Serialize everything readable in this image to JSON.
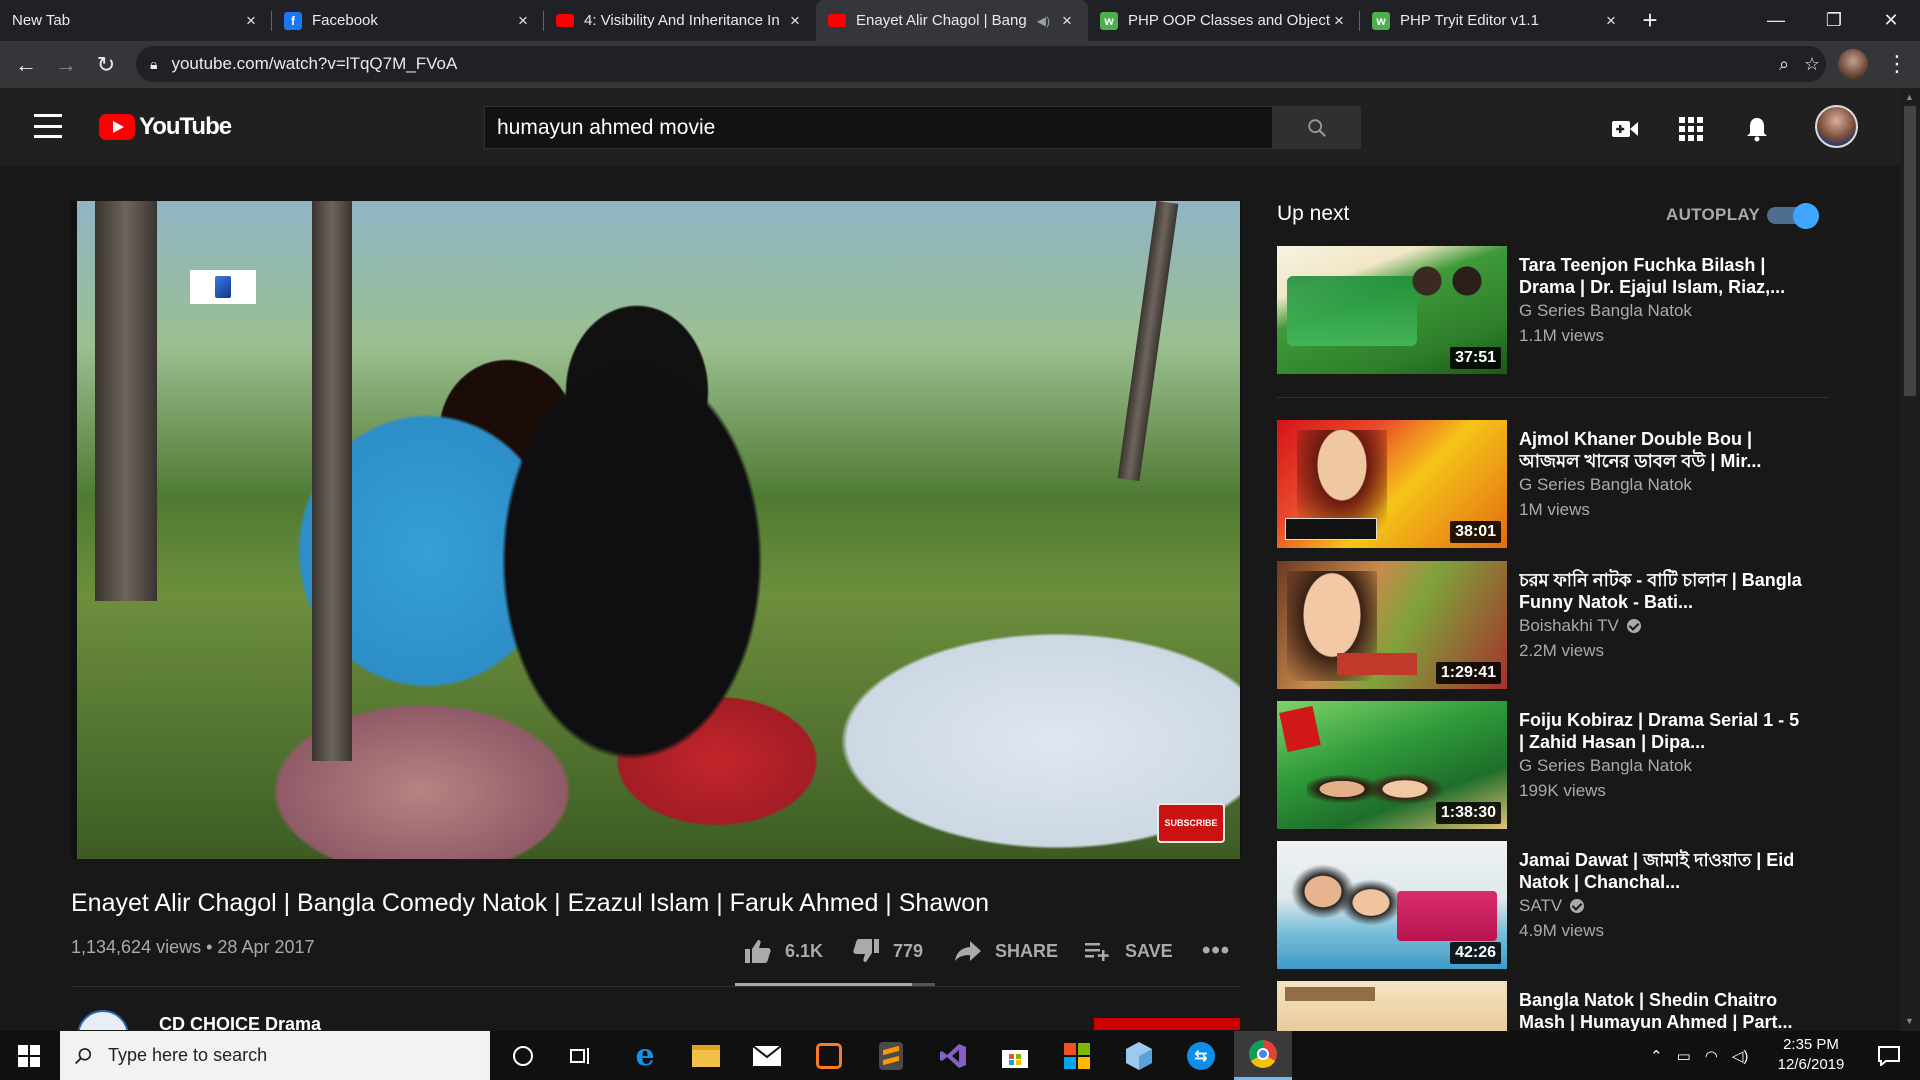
{
  "browser": {
    "tabs": [
      {
        "title": "New Tab",
        "favicon": "chrome-newtab",
        "active": false
      },
      {
        "title": "Facebook",
        "favicon": "facebook-icon",
        "active": false
      },
      {
        "title": "4: Visibility And Inheritance In",
        "favicon": "youtube-icon",
        "active": false
      },
      {
        "title": "Enayet Alir Chagol | Bang",
        "favicon": "youtube-icon",
        "active": true,
        "audio": true
      },
      {
        "title": "PHP OOP Classes and Objects",
        "favicon": "tryit-icon",
        "active": false
      },
      {
        "title": "PHP Tryit Editor v1.1",
        "favicon": "tryit-icon",
        "active": false
      }
    ],
    "url": "youtube.com/watch?v=lTqQ7M_FVoA"
  },
  "masthead": {
    "logo_text": "YouTube",
    "search_value": "humayun ahmed movie"
  },
  "video": {
    "title": "Enayet Alir Chagol | Bangla Comedy Natok | Ezazul Islam | Faruk Ahmed | Shawon",
    "views": "1,134,624 views",
    "date": "28 Apr 2017",
    "likes": "6.1K",
    "dislikes": "779",
    "share_label": "SHARE",
    "save_label": "SAVE",
    "like_ratio": 0.887,
    "overlay_subscribe": "SUBSCRIBE",
    "channel": "CD CHOICE Drama",
    "subscribe_label": "SUBSCRIBE"
  },
  "sidebar": {
    "upnext_label": "Up next",
    "autoplay_label": "AUTOPLAY",
    "autoplay_on": true,
    "items": [
      {
        "title": "Tara Teenjon Fuchka Bilash | Drama | Dr. Ejajul Islam, Riaz,...",
        "channel": "G Series Bangla Natok",
        "views": "1.1M views",
        "duration": "37:51",
        "verified": false
      },
      {
        "title": "Ajmol Khaner Double Bou | আজমল খানের ডাবল বউ | Mir...",
        "channel": "G Series Bangla Natok",
        "views": "1M views",
        "duration": "38:01",
        "verified": false
      },
      {
        "title": "চরম ফানি নাটক - বাটি চালান | Bangla Funny Natok - Bati...",
        "channel": "Boishakhi TV",
        "views": "2.2M views",
        "duration": "1:29:41",
        "verified": true
      },
      {
        "title": "Foiju Kobiraz | Drama Serial 1 - 5 | Zahid Hasan | Dipa...",
        "channel": "G Series Bangla Natok",
        "views": "199K views",
        "duration": "1:38:30",
        "verified": false
      },
      {
        "title": "Jamai Dawat | জামাই দাওয়াত | Eid Natok | Chanchal...",
        "channel": "SATV",
        "views": "4.9M views",
        "duration": "42:26",
        "verified": true
      },
      {
        "title": "Bangla Natok | Shedin Chaitro Mash | Humayun Ahmed | Part...",
        "channel": "",
        "views": "",
        "duration": "",
        "verified": false
      }
    ]
  },
  "taskbar": {
    "search_placeholder": "Type here to search",
    "time": "2:35 PM",
    "date": "12/6/2019"
  },
  "colors": {
    "yt_red": "#ff0000",
    "page_bg": "#181818",
    "masthead_bg": "#202020",
    "toggle_blue": "#3ea6ff"
  }
}
